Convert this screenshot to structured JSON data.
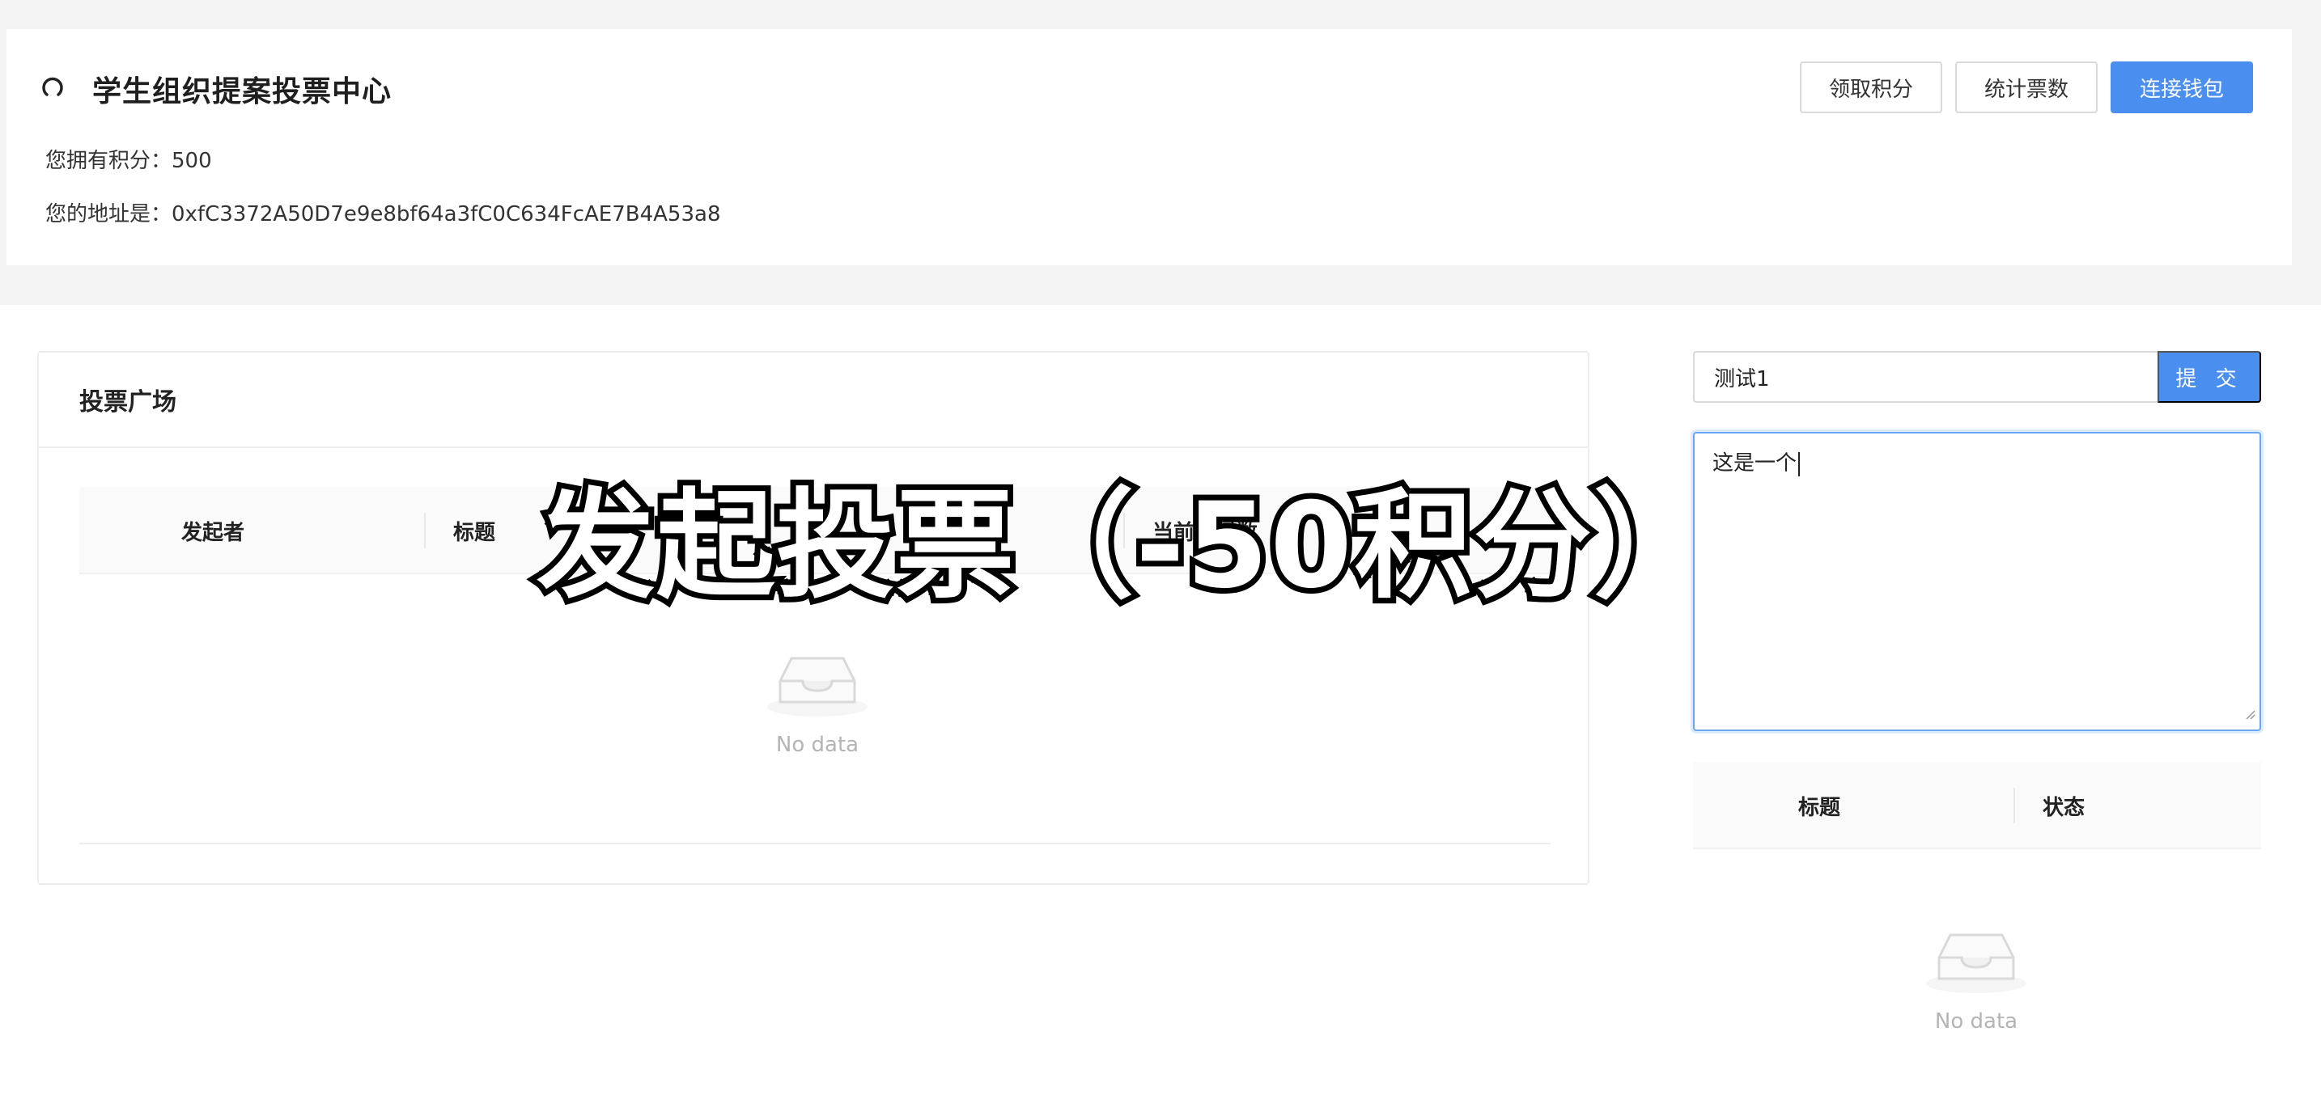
{
  "header": {
    "title": "学生组织提案投票中心",
    "points_line": "您拥有积分：500",
    "address_line": "您的地址是：0xfC3372A50D7e9e8bf64a3fC0C634FcAE7B4A53a8",
    "buttons": {
      "claim": "领取积分",
      "count": "统计票数",
      "connect": "连接钱包"
    }
  },
  "square": {
    "title": "投票广场",
    "columns": [
      "发起者",
      "标题",
      "当前反对数"
    ],
    "empty_text": "No data"
  },
  "proposal_form": {
    "title_value": "测试1",
    "submit_label": "提 交",
    "description_value": "这是一个"
  },
  "my_proposals": {
    "columns": [
      "标题",
      "状态"
    ],
    "empty_text": "No data"
  },
  "overlay": {
    "caption": "发起投票（-50积分）"
  },
  "colors": {
    "primary": "#4a8fef",
    "page_band": "#f4f4f4",
    "empty_text": "#b4b4b4"
  }
}
